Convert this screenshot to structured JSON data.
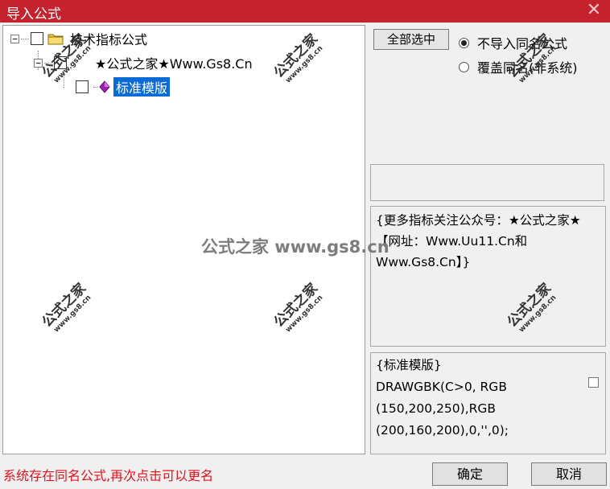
{
  "window": {
    "title": "导入公式",
    "close_glyph": "✕"
  },
  "tree": {
    "nodes": [
      {
        "expander": "−",
        "label": "技术指标公式",
        "icon": "folder-icon",
        "checked": false
      },
      {
        "expander": "−",
        "label": "★公式之家★Www.Gs8.Cn",
        "checked": false
      },
      {
        "label": "标准模版",
        "icon": "formula-gem-icon",
        "checked": false,
        "selected": true
      }
    ]
  },
  "options": {
    "select_all_label": "全部选中",
    "radio_no_import_same_name": "不导入同名公式",
    "radio_overwrite_same_name": "覆盖同名(非系统)",
    "selected_radio": "no_import_same_name"
  },
  "info": {
    "description": "{更多指标关注公众号：★公式之家★【网址：Www.Uu11.Cn和Www.Gs8.Cn】}"
  },
  "code": {
    "text": "{标准模版}\nDRAWGBK(C>0, RGB\n(150,200,250),RGB\n(200,160,200),0,'',0);"
  },
  "status": {
    "message": "系统存在同名公式,再次点击可以更名"
  },
  "buttons": {
    "ok_label": "确定",
    "cancel_label": "取消"
  },
  "watermark": {
    "center_text": "公式之家 www.gs8.cn",
    "stamp_cn": "公式之家",
    "stamp_url": "www.gs8.cn"
  },
  "colors": {
    "titlebar": "#c4232d",
    "selection": "#0a6ad6",
    "status_text": "#e0141e"
  }
}
